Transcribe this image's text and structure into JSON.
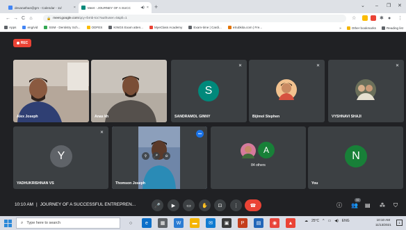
{
  "browser": {
    "tabs": [
      {
        "title": "devanathan@gm - Calendar - 11/",
        "favicon_color": "#4285f4"
      },
      {
        "title": "Meet - JOURNEY OF A SUCC",
        "favicon_color": "#00897b"
      }
    ],
    "new_tab": "+",
    "address": {
      "host": "meet.google.com",
      "path": "/qcy-rbmb-toc?authuser=0&pli=1"
    },
    "bookmarks": [
      {
        "label": "Apps",
        "color": "#5f6368"
      },
      {
        "label": "eng/vid",
        "color": "#4285f4"
      },
      {
        "label": "SSM - Dentistry Sch...",
        "color": "#34a853"
      },
      {
        "label": "ODFES",
        "color": "#fbbc04"
      },
      {
        "label": "KINGS Exam atten...",
        "color": "#5f6368"
      },
      {
        "label": "MyeClass Academy",
        "color": "#ea4335"
      },
      {
        "label": "Exam-time | Cardi...",
        "color": "#5f6368"
      },
      {
        "label": "eSubkita.com | Fre...",
        "color": "#e37400"
      }
    ],
    "bookmarks_more": "»",
    "other_bookmarks": "Other bookmarks",
    "reading_list": "Reading list"
  },
  "meet": {
    "rec_label": "REC",
    "participants": [
      {
        "name": "Alex Joseph",
        "type": "video"
      },
      {
        "name": "Anas kh",
        "type": "video"
      },
      {
        "name": "SANDRAMOL GINNY",
        "type": "avatar",
        "initial": "S",
        "color": "#00897b"
      },
      {
        "name": "Bijimol Stephen",
        "type": "photo"
      },
      {
        "name": "VYSHNAVI SHAJI",
        "type": "photo"
      },
      {
        "name": "YADHUKRISHNAN VS",
        "type": "avatar",
        "initial": "Y",
        "color": "#5f6368"
      },
      {
        "name": "Thomson Joseph",
        "type": "video"
      },
      {
        "name": "84 others",
        "type": "group",
        "initial": "A",
        "color": "#188038"
      },
      {
        "name": "You",
        "type": "avatar",
        "initial": "N",
        "color": "#188038"
      }
    ],
    "time": "10:10 AM",
    "meeting_title": "JOURNEY OF A SUCCESSFUL ENTREPREN...",
    "people_count": "92"
  },
  "taskbar": {
    "search_placeholder": "Type here to search",
    "weather": "25°C",
    "language": "ENG",
    "time": "10:10 AM",
    "date": "11/13/2021",
    "notifications": "1"
  },
  "colors": {
    "meet_bg": "#202124",
    "tile_bg": "#3c4043",
    "accent_blue": "#8ab4f8",
    "end_call": "#ea4335"
  }
}
